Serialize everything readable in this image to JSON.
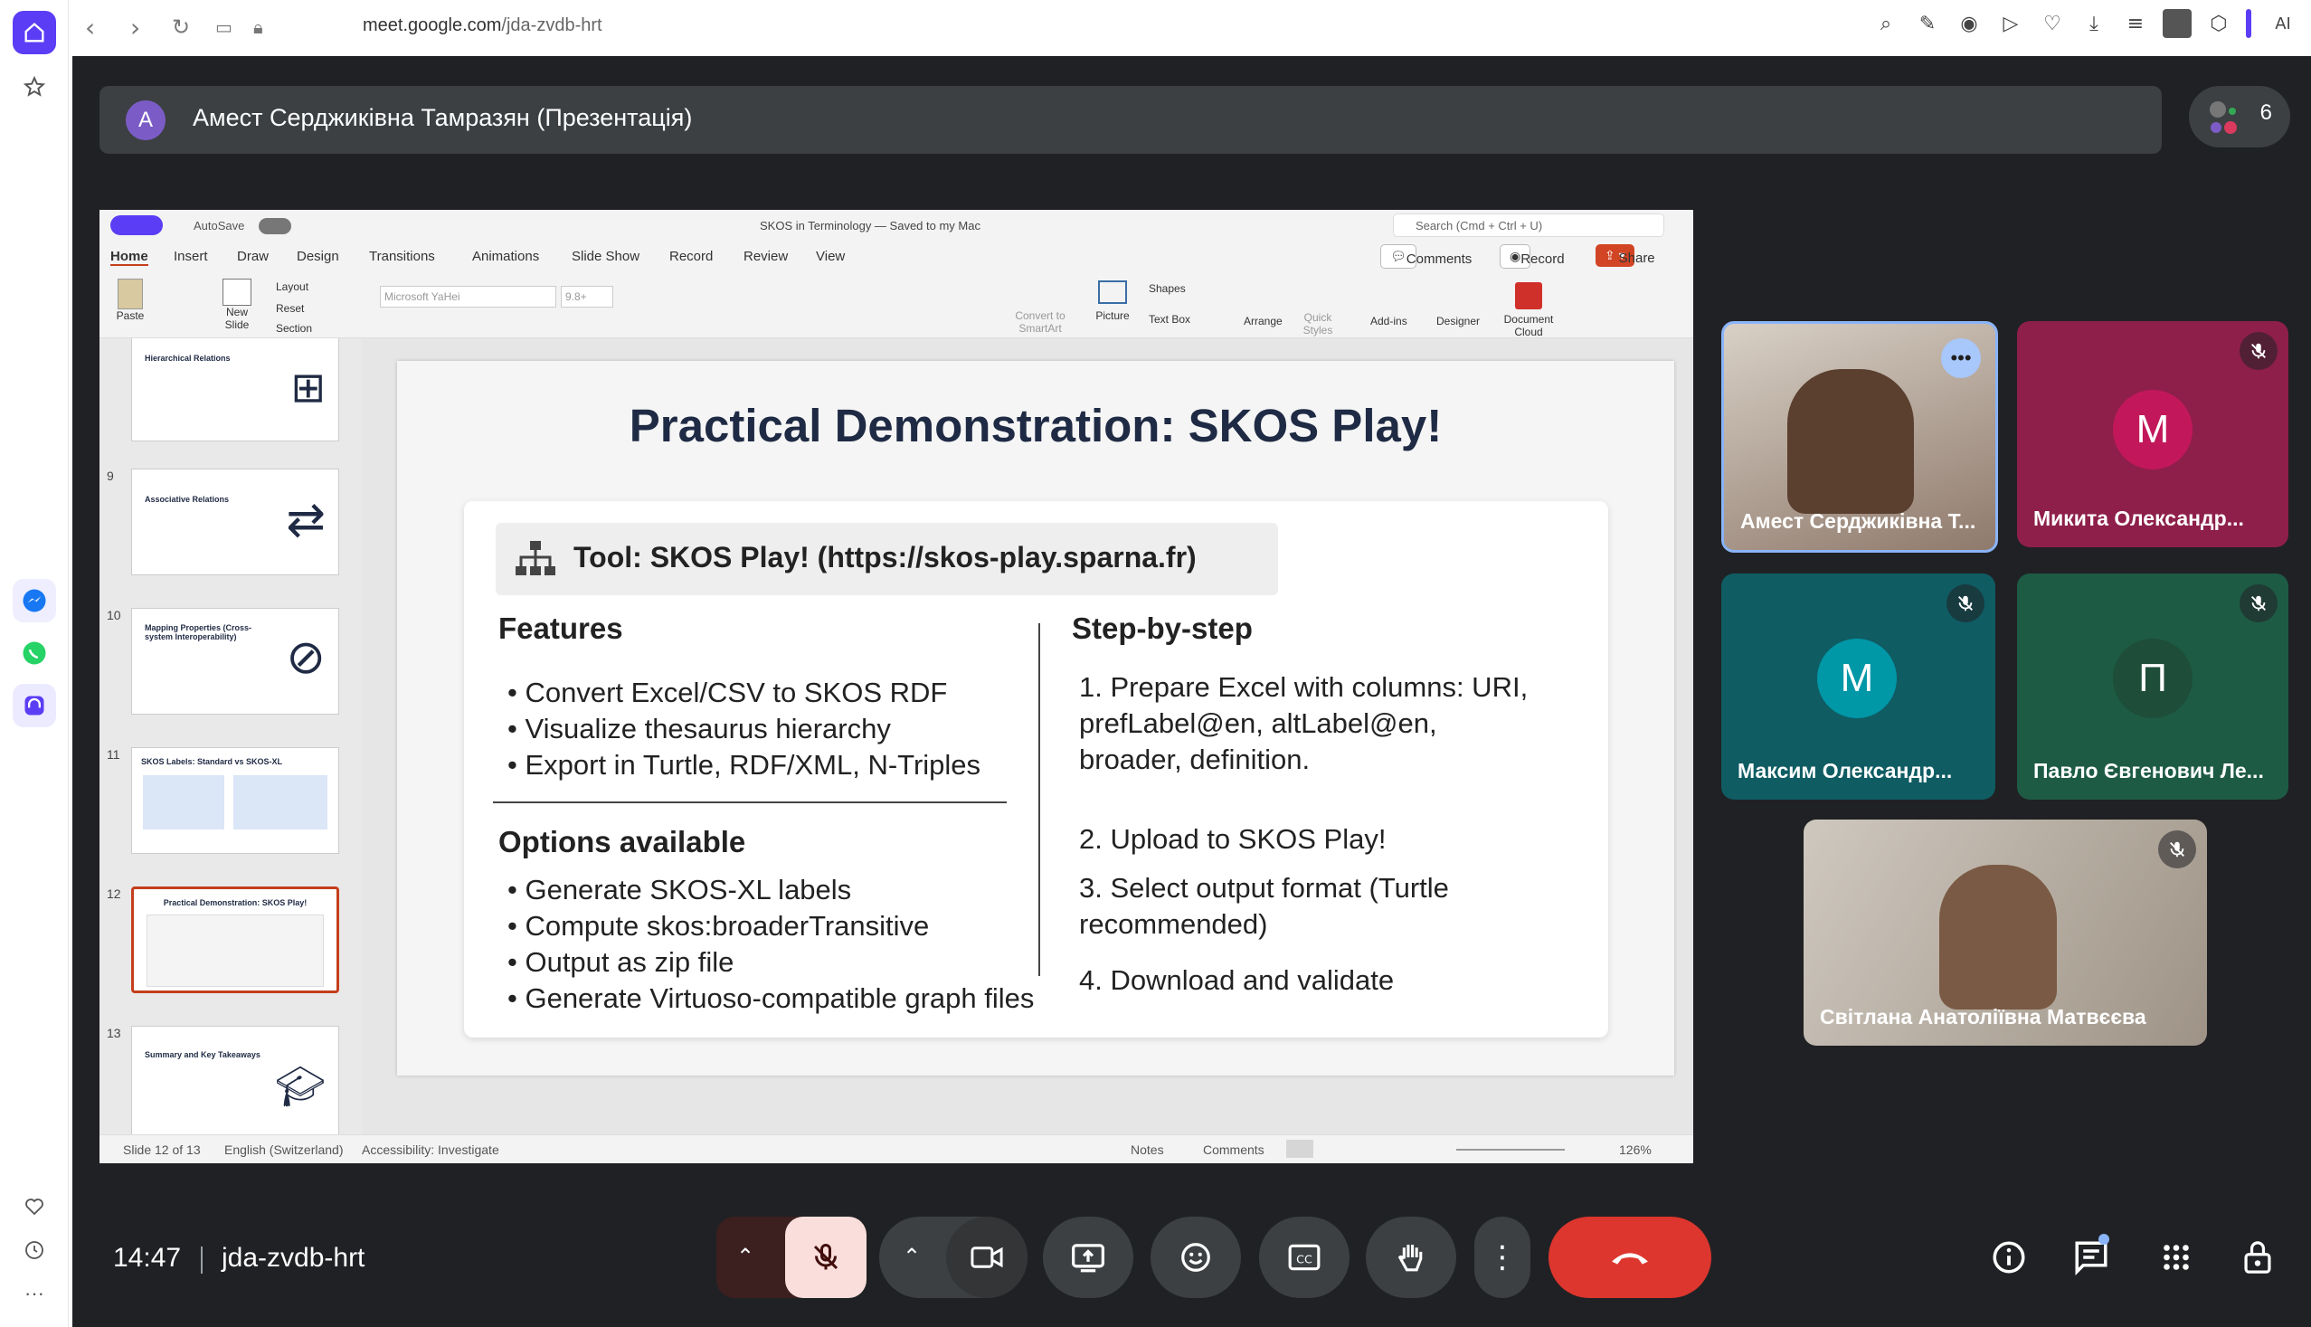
{
  "browser": {
    "url_host": "meet.google.com",
    "url_path": "/jda-zvdb-hrt",
    "ai_label": "AI"
  },
  "presenter": {
    "initial": "A",
    "title": "Амест Серджиківна Тамразян (Презентація)"
  },
  "participants_count": "6",
  "ppt": {
    "autosave": "AutoSave",
    "doc_title": "SKOS in Terminology — Saved to my Mac",
    "search": "Search (Cmd + Ctrl + U)",
    "tabs": [
      "Home",
      "Insert",
      "Draw",
      "Design",
      "Transitions",
      "Animations",
      "Slide Show",
      "Record",
      "Review",
      "View"
    ],
    "comments": "Comments",
    "record": "Record",
    "share": "Share",
    "ribbon": {
      "paste": "Paste",
      "new_slide": "New Slide",
      "layout": "Layout",
      "reset": "Reset",
      "section": "Section",
      "font": "Microsoft YaHei",
      "size": "9.8+",
      "convert": "Convert to SmartArt",
      "picture": "Picture",
      "shapes": "Shapes",
      "textbox": "Text Box",
      "arrange": "Arrange",
      "quick_styles": "Quick Styles",
      "addins": "Add-ins",
      "designer": "Designer",
      "doc_cloud": "Document Cloud"
    },
    "thumbs": [
      {
        "num": "",
        "title": "Hierarchical Relations"
      },
      {
        "num": "9",
        "title": "Associative Relations"
      },
      {
        "num": "10",
        "title": "Mapping Properties (Cross-system Interoperability)"
      },
      {
        "num": "11",
        "title": "SKOS Labels: Standard vs SKOS-XL"
      },
      {
        "num": "12",
        "title": "Practical Demonstration: SKOS Play!"
      },
      {
        "num": "13",
        "title": "Summary and Key Takeaways"
      }
    ],
    "slide": {
      "title": "Practical Demonstration: SKOS Play!",
      "tool": "Tool: SKOS Play! (https://skos-play.sparna.fr)",
      "features_h": "Features",
      "features": [
        "• Convert Excel/CSV to SKOS RDF",
        "• Visualize thesaurus hierarchy",
        "• Export in Turtle, RDF/XML, N-Triples"
      ],
      "options_h": "Options available",
      "options": [
        "• Generate SKOS-XL labels",
        "• Compute skos:broaderTransitive",
        "• Output as zip file",
        "• Generate Virtuoso-compatible graph files"
      ],
      "steps_h": "Step-by-step",
      "step1": [
        "1. Prepare Excel with columns: URI,",
        "prefLabel@en, altLabel@en,",
        "broader, definition."
      ],
      "step2": "2. Upload to SKOS Play!",
      "step3": [
        "3. Select output format (Turtle",
        "recommended)"
      ],
      "step4": "4. Download and validate"
    },
    "status": {
      "slide": "Slide 12 of 13",
      "lang": "English (Switzerland)",
      "access": "Accessibility: Investigate",
      "notes": "Notes",
      "comments": "Comments",
      "zoom": "126%"
    }
  },
  "tiles": [
    {
      "name": "Амест Серджиківна Т...",
      "initial": "",
      "color": "#9a8a7c"
    },
    {
      "name": "Микита Олександр...",
      "initial": "M",
      "color": "#8e1f4a"
    },
    {
      "name": "Максим Олександр...",
      "initial": "M",
      "color": "#0f5c63"
    },
    {
      "name": "Павло Євгенович Ле...",
      "initial": "П",
      "color": "#1d5b45"
    },
    {
      "name": "Світлана Анатоліївна Матвєєва",
      "initial": "",
      "color": "#b8b4ad"
    }
  ],
  "bottom": {
    "time": "14:47",
    "meeting_code": "jda-zvdb-hrt"
  }
}
